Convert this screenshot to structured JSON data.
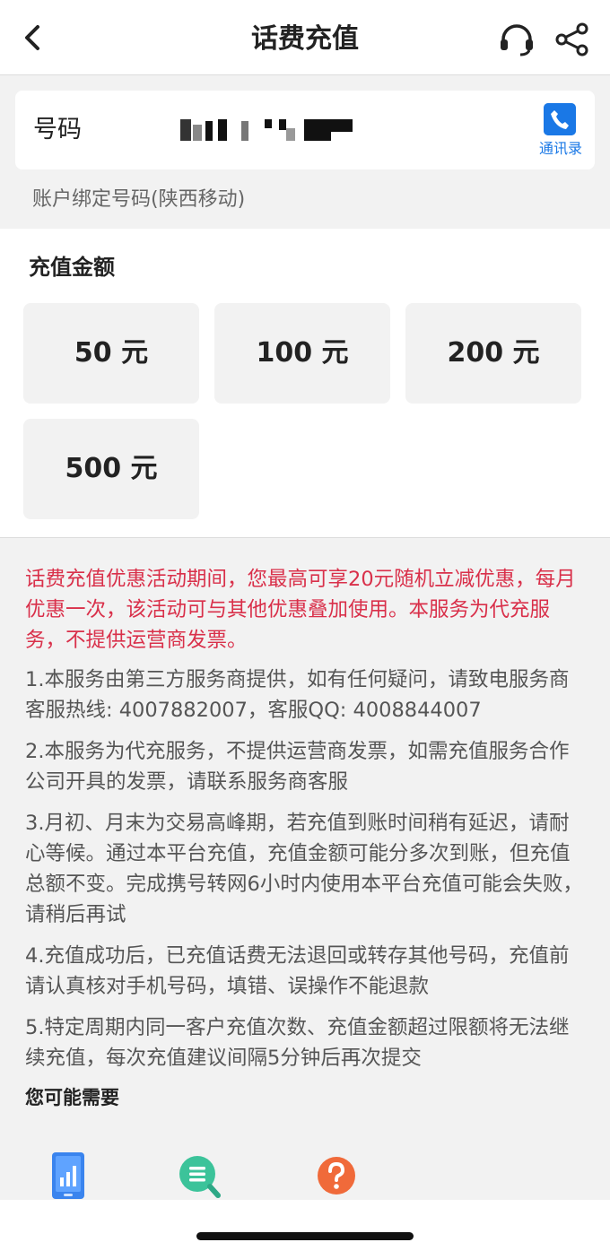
{
  "nav": {
    "title": "话费充值"
  },
  "phone": {
    "label": "号码",
    "contacts_label": "通讯录",
    "account_note": "账户绑定号码(陕西移动)"
  },
  "amount": {
    "title": "充值金额",
    "options": [
      "50 元",
      "100 元",
      "200 元",
      "500 元"
    ]
  },
  "info": {
    "promo": "话费充值优惠活动期间，您最高可享20元随机立减优惠，每月优惠一次，该活动可与其他优惠叠加使用。本服务为代充服务，不提供运营商发票。",
    "rules": [
      "1.本服务由第三方服务商提供，如有任何疑问，请致电服务商客服热线: 4007882007，客服QQ: 4008844007",
      "2.本服务为代充服务，不提供运营商发票，如需充值服务合作公司开具的发票，请联系服务商客服",
      "3.月初、月末为交易高峰期，若充值到账时间稍有延迟，请耐心等候。通过本平台充值，充值金额可能分多次到账，但充值总额不变。完成携号转网6小时内使用本平台充值可能会失败，请稍后再试",
      "4.充值成功后，已充值话费无法退回或转存其他号码，充值前请认真核对手机号码，填错、误操作不能退款",
      "5.特定周期内同一客户充值次数、充值金额超过限额将无法继续充值，每次充值建议间隔5分钟后再次提交"
    ],
    "maybe_title": "您可能需要"
  },
  "colors": {
    "accent_blue": "#1a78e6",
    "promo_red": "#d9304a",
    "help_orange": "#f06a3a",
    "search_green": "#3cc39a"
  }
}
